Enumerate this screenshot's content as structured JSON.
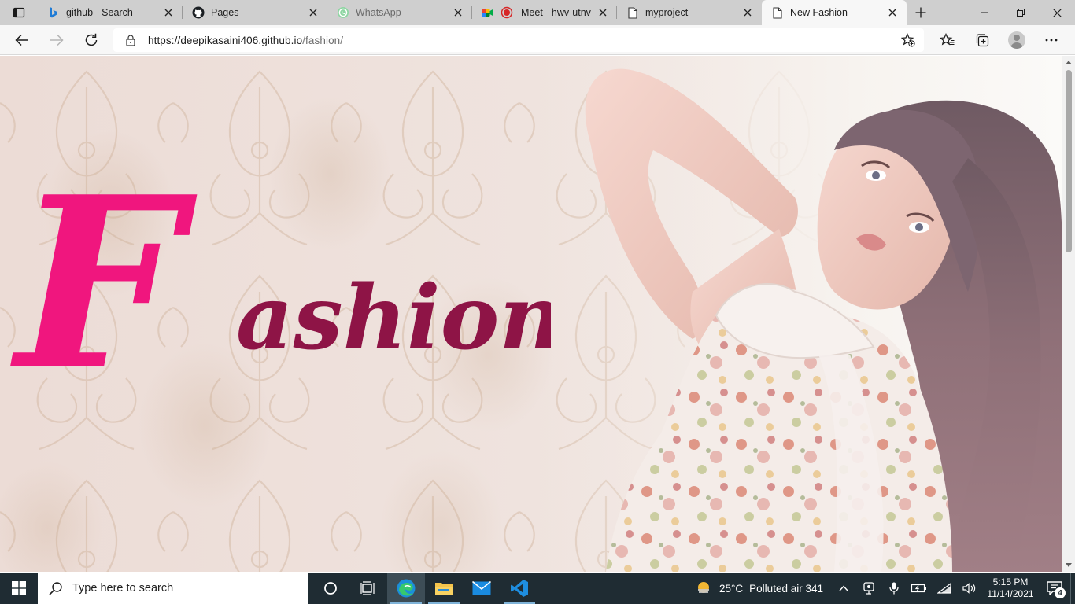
{
  "browser": {
    "tabs": [
      {
        "title": "github - Search",
        "icon": "bing-icon",
        "active": false
      },
      {
        "title": "Pages",
        "icon": "github-icon",
        "active": false
      },
      {
        "title": "WhatsApp",
        "icon": "whatsapp-icon",
        "active": false
      },
      {
        "title": "Meet - hwv-utnv-",
        "icon": "google-meet-icon",
        "active": false
      },
      {
        "title": "myproject",
        "icon": "page-icon",
        "active": false
      },
      {
        "title": "New Fashion",
        "icon": "page-icon",
        "active": true
      }
    ],
    "url": {
      "host": "https://deepikasaini406.github.io",
      "path": "/fashion/"
    }
  },
  "page": {
    "hero": {
      "brand_initial": "F",
      "brand_rest": "ashion",
      "initial_color": "#f0167e",
      "rest_color": "#8e1446"
    }
  },
  "taskbar": {
    "search_placeholder": "Type here to search",
    "pinned_apps": [
      "task-view",
      "edge",
      "file-explorer",
      "mail",
      "vs-code"
    ],
    "weather": {
      "temperature": "25°C",
      "condition": "Polluted air 341"
    },
    "clock": {
      "time": "5:15 PM",
      "date": "11/14/2021"
    },
    "notification_count": "4"
  }
}
